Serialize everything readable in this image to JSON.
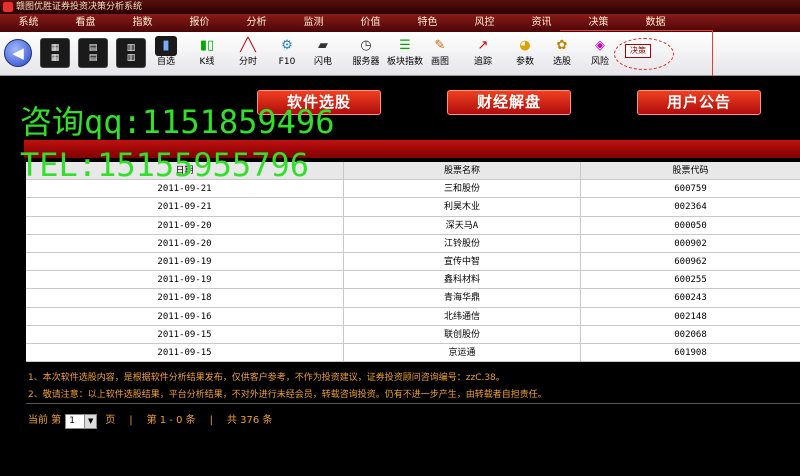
{
  "title": "赣图优胜证券投资决策分析系统",
  "menu": [
    "系统",
    "看盘",
    "指数",
    "报价",
    "分析",
    "监测",
    "价值",
    "特色",
    "风控",
    "资讯",
    "决策",
    "数据"
  ],
  "toolbar": {
    "tools": [
      {
        "label": "自选",
        "icon": "monitor-icon",
        "color": "#1a1a1a"
      },
      {
        "label": "K线",
        "icon": "candlestick-icon",
        "color": "#ffffff"
      },
      {
        "label": "分时",
        "icon": "line-chart-icon",
        "color": "#ffffff"
      },
      {
        "label": "F10",
        "icon": "gear-icon",
        "color": "#dfeeff"
      },
      {
        "label": "闪电",
        "icon": "car-icon",
        "color": "#ffffff"
      },
      {
        "label": "服务器",
        "icon": "clock-icon",
        "color": "#ffffff"
      },
      {
        "label": "板块指数",
        "icon": "stack-icon",
        "color": "#ffffff"
      },
      {
        "label": "画图",
        "icon": "paint-icon",
        "color": "#ffffff"
      },
      {
        "label": "追踪",
        "icon": "trend-icon",
        "color": "#ffffff"
      },
      {
        "label": "参数",
        "icon": "pie-icon",
        "color": "#ffffff"
      },
      {
        "label": "选股",
        "icon": "palette-icon",
        "color": "#ffffff"
      },
      {
        "label": "风险",
        "icon": "risk-icon",
        "color": "#ffffff"
      }
    ],
    "decision": "决策"
  },
  "features": [
    "软件选股",
    "财经解盘",
    "用户公告"
  ],
  "watermark": {
    "line1": "咨询qq:1151859496",
    "line2": "TEL:15155955796"
  },
  "table": {
    "headers": [
      "日期",
      "股票名称",
      "股票代码"
    ],
    "rows": [
      [
        "2011-09-21",
        "三和股份",
        "600759"
      ],
      [
        "2011-09-21",
        "利昊木业",
        "002364"
      ],
      [
        "2011-09-20",
        "深天马A",
        "000050"
      ],
      [
        "2011-09-20",
        "江铃股份",
        "000902"
      ],
      [
        "2011-09-19",
        "宣传中智",
        "600962"
      ],
      [
        "2011-09-19",
        "鑫科材料",
        "600255"
      ],
      [
        "2011-09-18",
        "青海华鼎",
        "600243"
      ],
      [
        "2011-09-16",
        "北纬通信",
        "002148"
      ],
      [
        "2011-09-15",
        "联创股份",
        "002068"
      ],
      [
        "2011-09-15",
        "京运通",
        "601908"
      ]
    ]
  },
  "notes": [
    "1、本次软件选股内容，是根据软件分析结果发布，仅供客户参考，不作为投资建议，证券投资顾问咨询编号：zzC.38。",
    "2、敬请注意：以上软件选股结果，平台分析结果，不对外进行未经会员，转载咨询投资。仍有不进一步产生，由转载者自担责任。"
  ],
  "pager": {
    "current_label": "当前 第",
    "page_value": "1",
    "page_unit": "页",
    "range": "第 1 - 0 条",
    "total": "共 376 条"
  }
}
